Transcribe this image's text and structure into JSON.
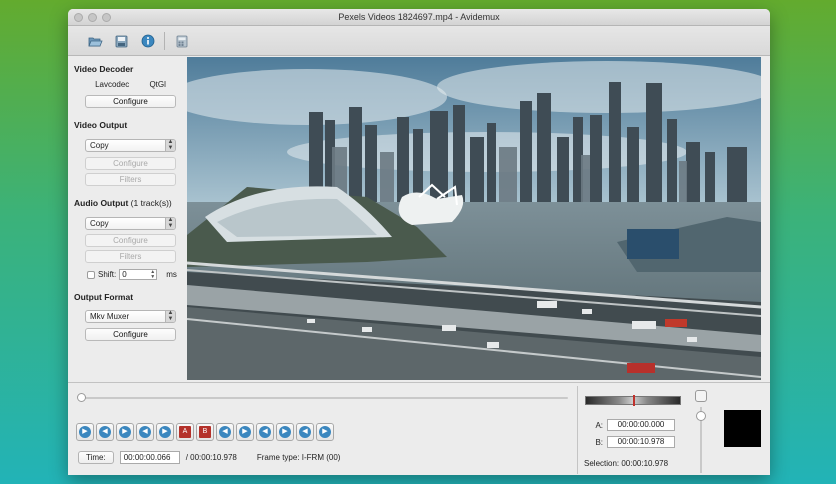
{
  "window": {
    "title": "Pexels Videos 1824697.mp4 - Avidemux"
  },
  "toolbar": {
    "icons": [
      "open-file-icon",
      "save-file-icon",
      "info-icon",
      "calculator-icon"
    ]
  },
  "video_decoder": {
    "title": "Video Decoder",
    "decoder_name": "Lavcodec",
    "decoder_type": "QtGl",
    "configure_label": "Configure"
  },
  "video_output": {
    "title": "Video Output",
    "selected": "Copy",
    "configure_label": "Configure",
    "filters_label": "Filters"
  },
  "audio_output": {
    "title": "Audio Output",
    "tracks": "(1 track(s))",
    "selected": "Copy",
    "configure_label": "Configure",
    "filters_label": "Filters",
    "shift_label": "Shift:",
    "shift_value": "0",
    "shift_unit": "ms"
  },
  "output_format": {
    "title": "Output Format",
    "selected": "Mkv Muxer",
    "configure_label": "Configure"
  },
  "playback": {
    "time_button": "Time:",
    "current_time": "00:00:00.066",
    "total_time": "/ 00:00:10.978",
    "frame_type": "Frame type:  I-FRM (00)",
    "position_fraction": 0.006
  },
  "selection": {
    "a_label": "A:",
    "a_value": "00:00:00.000",
    "b_label": "B:",
    "b_value": "00:00:10.978",
    "selection_text": "Selection: 00:00:10.978"
  },
  "colors": {
    "accent_blue": "#3b87bf",
    "marker_red": "#b4312a"
  }
}
